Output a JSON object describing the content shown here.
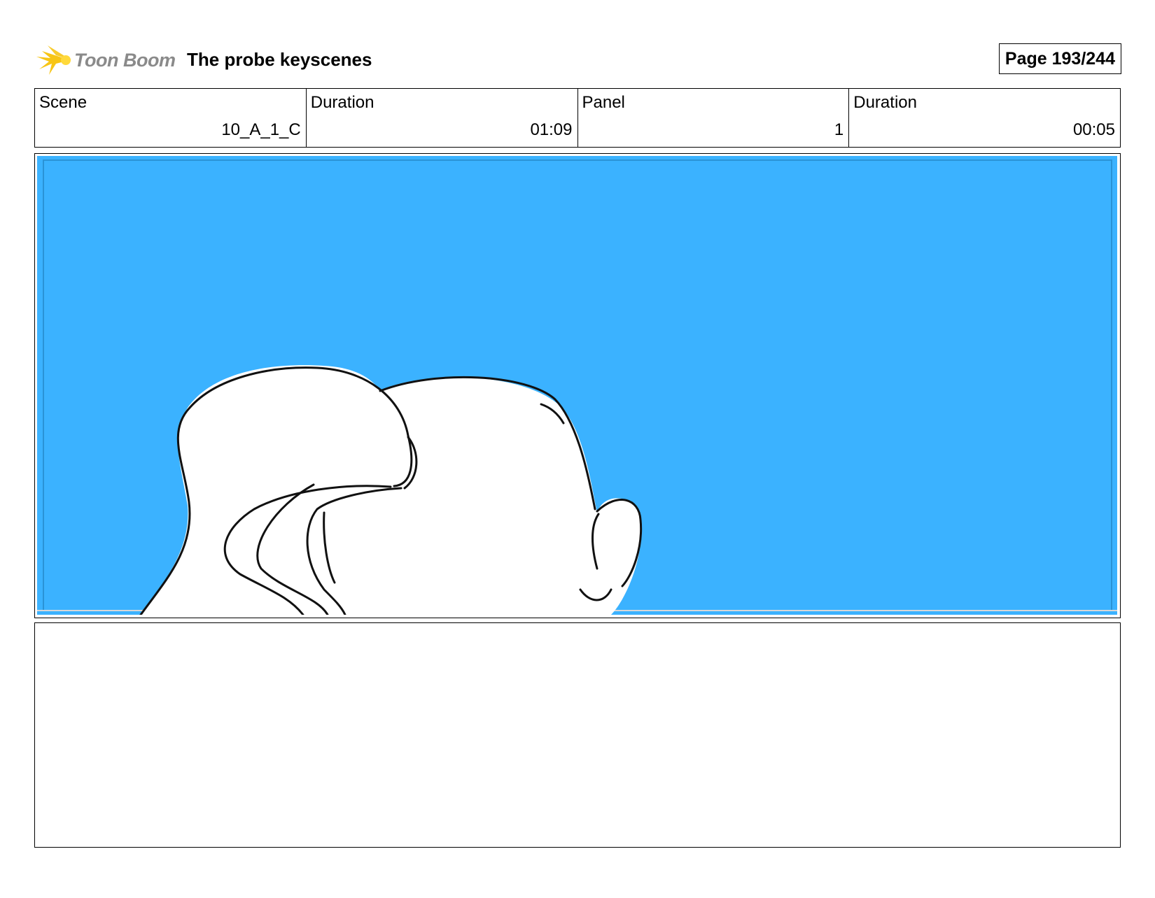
{
  "header": {
    "logo_text": "Toon Boom",
    "title": "The probe keyscenes",
    "page": "Page 193/244"
  },
  "info": [
    {
      "label": "Scene",
      "value": "10_A_1_C"
    },
    {
      "label": "Duration",
      "value": "01:09"
    },
    {
      "label": "Panel",
      "value": "1"
    },
    {
      "label": "Duration",
      "value": "00:05"
    }
  ],
  "colors": {
    "sky": "#3BB2FF",
    "logo_flame": "#F7C515",
    "logo_text": "#8A8A8A"
  },
  "notes": {
    "text": ""
  }
}
